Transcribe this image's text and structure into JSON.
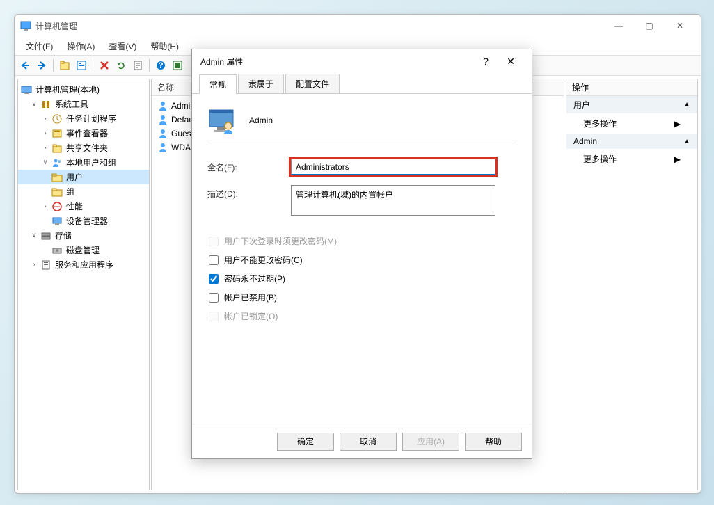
{
  "main": {
    "title": "计算机管理",
    "menu": {
      "file": "文件(F)",
      "action": "操作(A)",
      "view": "查看(V)",
      "help": "帮助(H)"
    }
  },
  "tree": {
    "root": "计算机管理(本地)",
    "systools": "系统工具",
    "scheduler": "任务计划程序",
    "eventviewer": "事件查看器",
    "shared": "共享文件夹",
    "localusers": "本地用户和组",
    "users": "用户",
    "groups": "组",
    "perf": "性能",
    "devmgr": "设备管理器",
    "storage": "存储",
    "diskmgmt": "磁盘管理",
    "services": "服务和应用程序"
  },
  "list": {
    "header": "名称",
    "items": [
      "Admin",
      "Defau",
      "Gues",
      "WDA"
    ]
  },
  "actions": {
    "header": "操作",
    "group1": "用户",
    "more1": "更多操作",
    "group2": "Admin",
    "more2": "更多操作"
  },
  "dialog": {
    "title": "Admin 属性",
    "tabs": {
      "general": "常规",
      "memberof": "隶属于",
      "profile": "配置文件"
    },
    "username": "Admin",
    "fullname_label": "全名(F):",
    "fullname_value": "Administrators",
    "desc_label": "描述(D):",
    "desc_value": "管理计算机(域)的内置帐户",
    "chk1": "用户下次登录时须更改密码(M)",
    "chk2": "用户不能更改密码(C)",
    "chk3": "密码永不过期(P)",
    "chk4": "帐户已禁用(B)",
    "chk5": "帐户已锁定(O)",
    "buttons": {
      "ok": "确定",
      "cancel": "取消",
      "apply": "应用(A)",
      "help": "帮助"
    }
  }
}
